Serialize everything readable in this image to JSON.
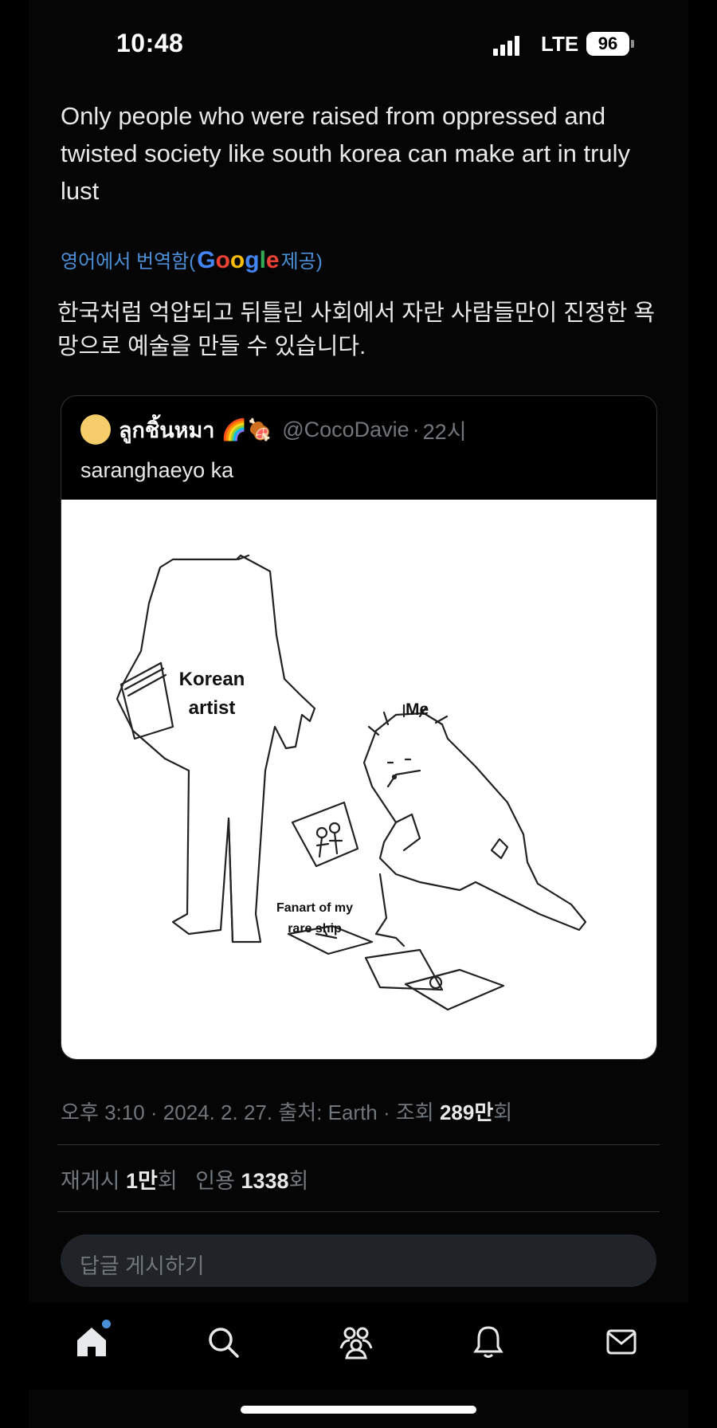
{
  "status_bar": {
    "time": "10:48",
    "network": "LTE",
    "battery": "96"
  },
  "tweet": {
    "text": "Only people who were raised from oppressed and twisted society like south korea can make art in truly lust",
    "translate_prefix": "영어에서 번역함(",
    "translate_logo": "Google",
    "translate_suffix": " 제공)",
    "translated_text": "한국처럼 억압되고 뒤틀린 사회에서 자란 사람들만이 진정한 욕망으로 예술을 만들 수 있습니다."
  },
  "quote": {
    "name": "ลูกชิ้นหมา",
    "emoji": "🌈🍖",
    "handle": "@CocoDavie",
    "time": "22시",
    "text": "saranghaeyo ka",
    "image_labels": {
      "korean_artist": "Korean artist",
      "me": "Me",
      "fanart": "Fanart of my rare ship"
    }
  },
  "meta": {
    "time_prefix": "오후 3:10 · 2024. 2. 27. 출처: Earth · 조회 ",
    "views": "289만",
    "views_suffix": "회"
  },
  "stats": {
    "reposts_label": "재게시 ",
    "reposts": "1만",
    "reposts_suffix": "회",
    "quotes_label": "인용 ",
    "quotes": "1338",
    "quotes_suffix": "회"
  },
  "reply": {
    "placeholder": "답글 게시하기"
  },
  "nav": {
    "items": [
      "home-icon",
      "search-icon",
      "communities-icon",
      "notifications-icon",
      "messages-icon"
    ]
  },
  "colors": {
    "link": "#4b8fd8",
    "accent": "#4a90d9",
    "muted": "#71767b"
  }
}
